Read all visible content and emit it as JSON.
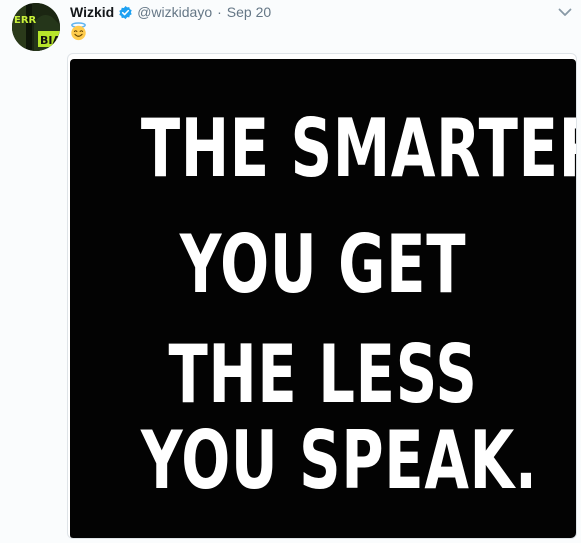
{
  "author": {
    "display_name": "Wizkid",
    "handle": "@wizkidayo",
    "separator": "·",
    "timestamp": "Sep 20",
    "avatar_text_top": "ERR",
    "avatar_text_bottom": "BIA"
  },
  "tweet": {
    "emoji": "😇"
  },
  "media": {
    "lines": [
      "THE SMARTER",
      "YOU GET",
      "THE LESS",
      "YOU SPEAK."
    ]
  },
  "icons": {
    "verified": "verified-badge-icon",
    "caret": "chevron-down-icon"
  },
  "colors": {
    "brand_blue": "#1da1f2",
    "secondary_text": "#657786",
    "poster_bg": "#030303",
    "poster_text": "#ffffff"
  }
}
